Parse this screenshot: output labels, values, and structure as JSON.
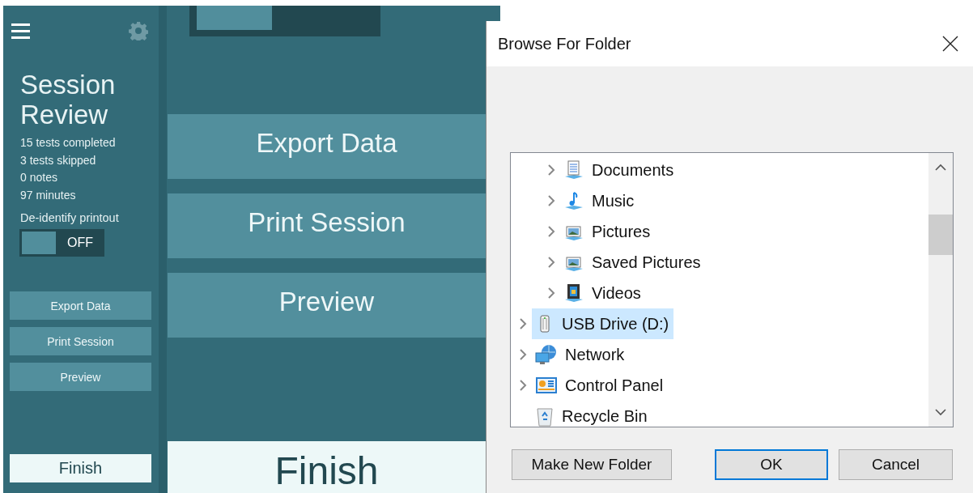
{
  "sidebar": {
    "title": "Session Review",
    "stats": [
      "15 tests completed",
      "3 tests skipped",
      "0 notes",
      "97 minutes"
    ],
    "deidentify": {
      "label": "De-identify printout",
      "state_text": "OFF",
      "on": false
    },
    "buttons": [
      {
        "label": "Export Data",
        "kind": "action"
      },
      {
        "label": "Print Session",
        "kind": "action"
      },
      {
        "label": "Preview",
        "kind": "action"
      },
      {
        "label": "Finish",
        "kind": "finish"
      }
    ]
  },
  "main": {
    "toggle": {
      "on": false
    },
    "buttons": [
      {
        "label": "Export Data",
        "kind": "action"
      },
      {
        "label": "Print Session",
        "kind": "action"
      },
      {
        "label": "Preview",
        "kind": "action"
      },
      {
        "label": "Finish",
        "kind": "finish"
      }
    ]
  },
  "dialog": {
    "title": "Browse For Folder",
    "tree": [
      {
        "children": [
          {
            "label": "Documents",
            "kind": "documents",
            "expandable": true,
            "selected": false
          },
          {
            "label": "Music",
            "kind": "music",
            "expandable": true,
            "selected": false
          },
          {
            "label": "Pictures",
            "kind": "pictures",
            "expandable": true,
            "selected": false
          },
          {
            "label": "Saved Pictures",
            "kind": "pictures",
            "expandable": true,
            "selected": false
          },
          {
            "label": "Videos",
            "kind": "videos",
            "expandable": true,
            "selected": false
          }
        ]
      },
      {
        "label": "USB Drive (D:)",
        "kind": "drive",
        "expandable": true,
        "selected": true
      },
      {
        "label": "Network",
        "kind": "network",
        "expandable": true,
        "selected": false
      },
      {
        "label": "Control Panel",
        "kind": "control-panel",
        "expandable": true,
        "selected": false
      },
      {
        "label": "Recycle Bin",
        "kind": "recycle-bin",
        "expandable": false,
        "selected": false
      }
    ],
    "buttons": [
      {
        "label": "Make New Folder",
        "default": false
      },
      {
        "label": "OK",
        "default": true
      },
      {
        "label": "Cancel",
        "default": false
      }
    ]
  }
}
